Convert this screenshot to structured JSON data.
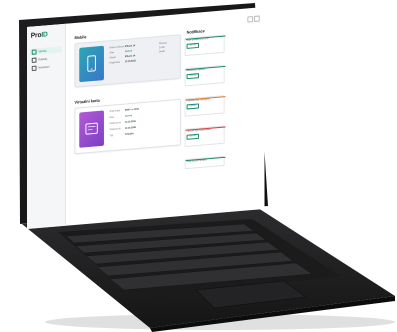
{
  "app": {
    "logo_prefix": "Pro",
    "logo_accent": "ID"
  },
  "sidebar": {
    "items": [
      {
        "label": "Identita",
        "active": true
      },
      {
        "label": "Doklady",
        "active": false
      },
      {
        "label": "Nastavení",
        "active": false
      }
    ]
  },
  "main": {
    "mobile_title": "Mobile",
    "mobile_fields": [
      {
        "key": "Název zařízení",
        "value": "iPhone 14"
      },
      {
        "key": "Stav",
        "value": "Aktivní"
      },
      {
        "key": "Model",
        "value": "iPhone 14"
      },
      {
        "key": "Registrace",
        "value": "12.10.2023"
      }
    ],
    "mobile_side_buttons": [
      "Obnovit",
      "Zrušit",
      "Detail"
    ],
    "card_title": "Virtuální karta",
    "card_fields": [
      {
        "key": "Číslo karty",
        "value": "4000 •••• 1234"
      },
      {
        "key": "Stav",
        "value": "Aktivní"
      },
      {
        "key": "Platnost od",
        "value": "12.10.2023"
      },
      {
        "key": "Platnost do",
        "value": "12.10.2028"
      },
      {
        "key": "Typ",
        "value": "Virtuální"
      }
    ]
  },
  "notifications": {
    "title": "Notifikace",
    "items": [
      {
        "text": "Nové přihlášení do účtu",
        "button": "Zobrazit",
        "color": "#1d8a6b"
      },
      {
        "text": "Aktualizace aplikace",
        "button": "Zobrazit",
        "color": "#1d8a6b"
      },
      {
        "text": "Platnost karty brzy vyprší",
        "button": "Obnovit",
        "color": "#e07a2c"
      },
      {
        "text": "Zařízení bylo zablokováno",
        "button": "Zobrazit",
        "color": "#d64545"
      },
      {
        "text": "Nové zařízení přidáno",
        "button": "",
        "color": "#1d8a6b"
      }
    ]
  },
  "colors": {
    "accent": "#1d8a6b",
    "mobile_tile_start": "#2aa7b5",
    "mobile_tile_end": "#3a76c9",
    "card_tile_start": "#b45ad6",
    "card_tile_end": "#7b3fc4"
  },
  "icons": [
    "phone-icon",
    "card-icon",
    "home-icon",
    "doc-icon",
    "settings-icon",
    "gear-icon"
  ]
}
